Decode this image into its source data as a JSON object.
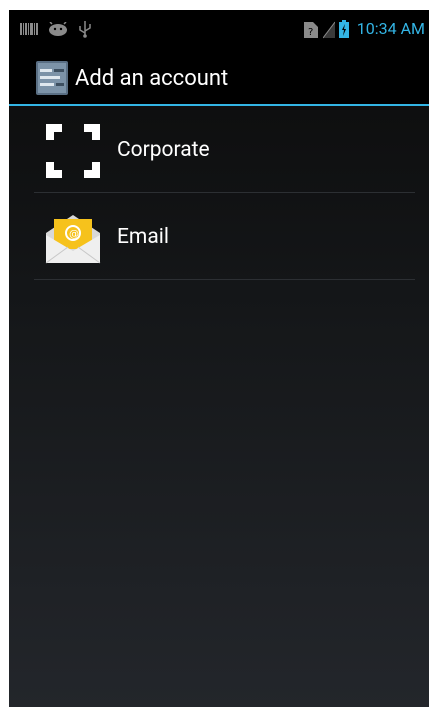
{
  "status_bar": {
    "left_icons": [
      "barcode-icon",
      "android-debug-icon",
      "usb-icon"
    ],
    "right_icons": [
      "no-sim-icon",
      "signal-icon",
      "battery-icon"
    ],
    "time": "10:34 AM"
  },
  "action_bar": {
    "icon": "account-settings-icon",
    "title": "Add an account"
  },
  "accounts": [
    {
      "label": "Corporate",
      "icon": "corporate-icon"
    },
    {
      "label": "Email",
      "icon": "email-icon"
    }
  ],
  "colors": {
    "accent": "#33b5e5",
    "background_top": "#0b0b0b",
    "background_bottom": "#23262b",
    "text": "#ffffff"
  }
}
